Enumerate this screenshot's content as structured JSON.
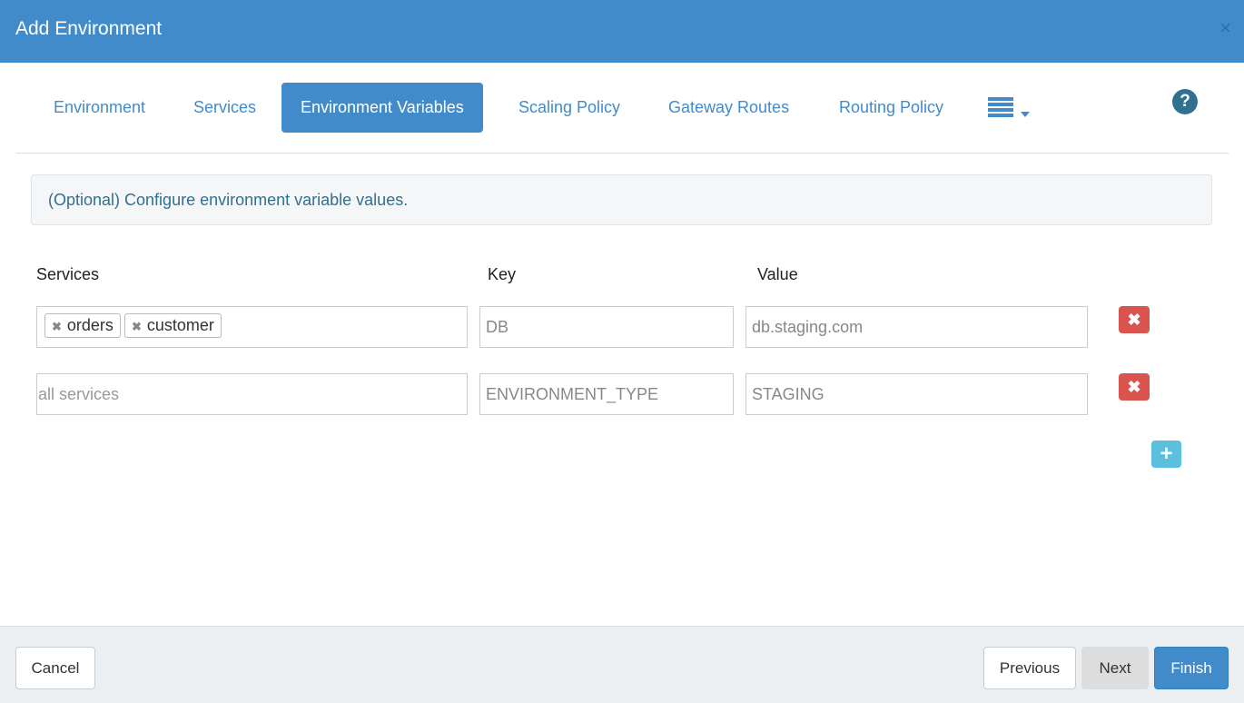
{
  "header": {
    "title": "Add Environment",
    "close": "×"
  },
  "tabs": [
    "Environment",
    "Services",
    "Environment Variables",
    "Scaling Policy",
    "Gateway Routes",
    "Routing Policy"
  ],
  "active_tab": "Environment Variables",
  "help": "?",
  "info": "(Optional) Configure environment variable values.",
  "columns": {
    "services": "Services",
    "key": "Key",
    "value": "Value"
  },
  "rows": [
    {
      "services": [
        "orders",
        "customer"
      ],
      "key": "DB",
      "value": "db.staging.com"
    },
    {
      "services_placeholder": "all services",
      "key": "ENVIRONMENT_TYPE",
      "value": "STAGING"
    }
  ],
  "footer": {
    "cancel": "Cancel",
    "previous": "Previous",
    "next": "Next",
    "finish": "Finish"
  },
  "colors": {
    "primary": "#428bca",
    "danger": "#d9534f",
    "info": "#5bc0de"
  }
}
